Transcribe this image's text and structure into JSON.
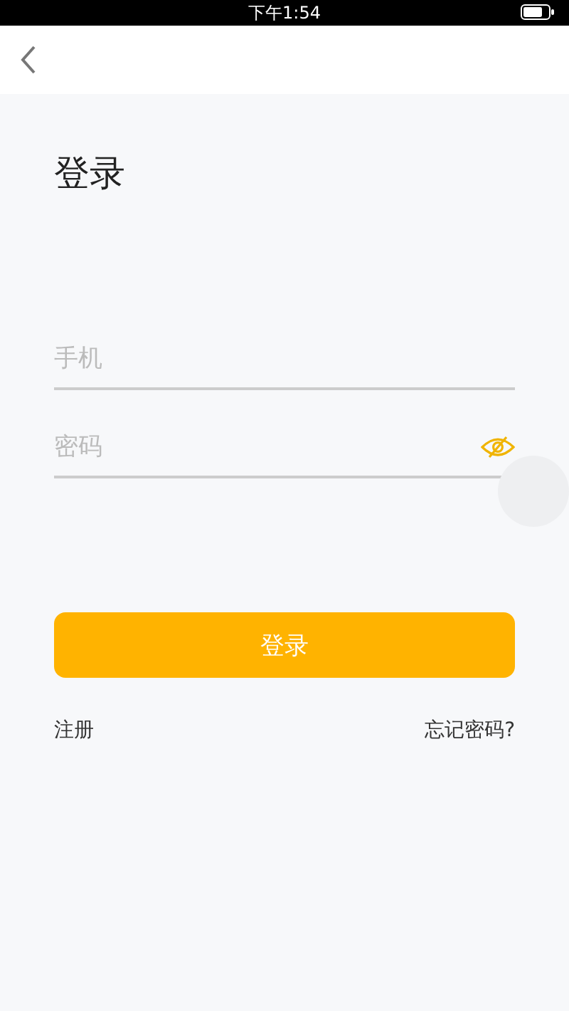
{
  "status_bar": {
    "time": "下午1:54"
  },
  "title": "登录",
  "phone_field": {
    "placeholder": "手机"
  },
  "password_field": {
    "placeholder": "密码",
    "password_visible": false
  },
  "login_button": "登录",
  "links": {
    "register": "注册",
    "forgot": "忘记密码?"
  }
}
